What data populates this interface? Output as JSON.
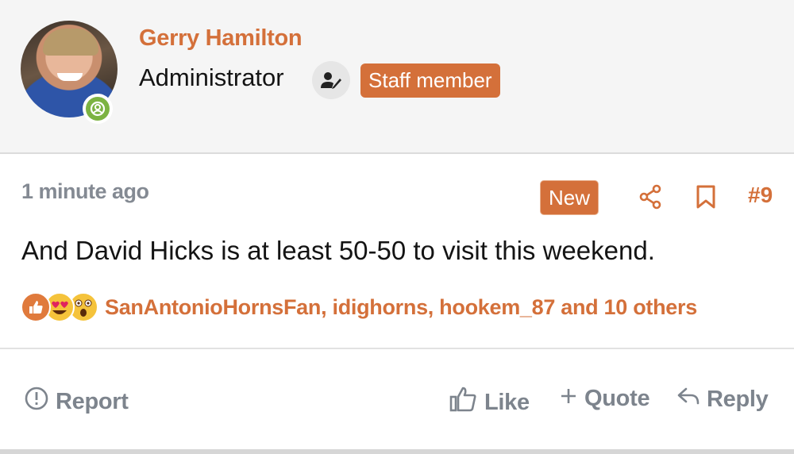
{
  "author": {
    "name": "Gerry Hamilton",
    "role": "Administrator",
    "staff_badge": "Staff member",
    "avatar_icon": "user-avatar-photo",
    "online_icon": "online-status-icon"
  },
  "post": {
    "time": "1 minute ago",
    "new_badge": "New",
    "number": "#9",
    "message": "And David Hicks is at least 50-50 to visit this weekend.",
    "reactions_icons": [
      "like-icon",
      "love-icon",
      "wow-icon"
    ],
    "reaction_users": "SanAntonioHornsFan, idighorns, hookem_87 and 10 others"
  },
  "actions": {
    "report": "Report",
    "like": "Like",
    "quote": "Quote",
    "reply": "Reply"
  },
  "colors": {
    "accent": "#d4703a",
    "muted": "#7d848d",
    "online": "#7cb342"
  }
}
